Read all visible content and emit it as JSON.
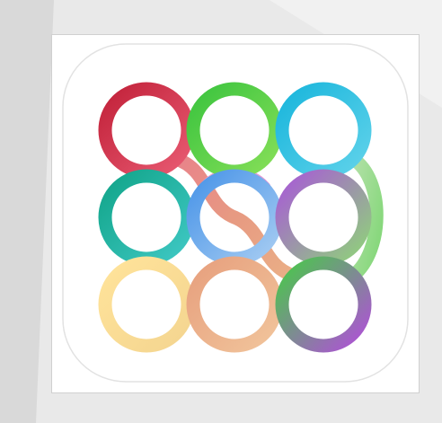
{
  "app_icon": {
    "name": "rings-app-icon",
    "tile_color": "#ffffff",
    "rings": [
      {
        "colors": [
          "#c2223a",
          "#e85a72"
        ]
      },
      {
        "colors": [
          "#3cc43f",
          "#86df58"
        ]
      },
      {
        "colors": [
          "#1ab6dc",
          "#5fd2ea"
        ]
      },
      {
        "colors": [
          "#12a58a",
          "#3fc8c4"
        ]
      },
      {
        "colors": [
          "#4a95e8",
          "#a6ccf2"
        ]
      },
      {
        "colors": [
          "#a85bd6",
          "#8fd27a"
        ]
      },
      {
        "colors": [
          "#ffe39a",
          "#f4d590"
        ]
      },
      {
        "colors": [
          "#e7a07e",
          "#f1c49b"
        ]
      },
      {
        "colors": [
          "#49c84a",
          "#b14fd9"
        ]
      }
    ],
    "connectors": [
      {
        "colors": [
          "#e8838a",
          "#e79a82"
        ]
      },
      {
        "colors": [
          "#e79a82",
          "#eaaf86"
        ]
      },
      {
        "colors": [
          "#b3e0a8",
          "#83d778"
        ]
      },
      {
        "colors": [
          "#efa4cf",
          "#d98fd8"
        ]
      }
    ]
  }
}
